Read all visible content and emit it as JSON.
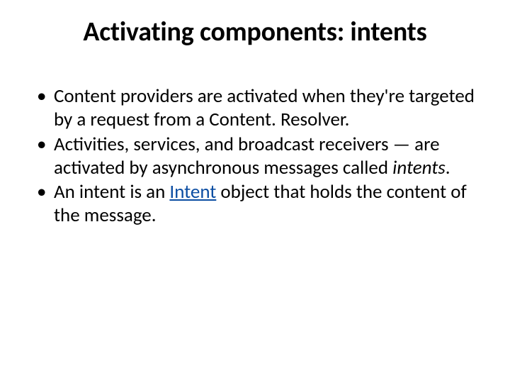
{
  "title": "Activating components: intents",
  "bullets": [
    {
      "pre": "Content providers are activated when they're targeted by a request from a Content. Resolver."
    },
    {
      "pre": "Activities, services, and broadcast receivers — are activated by asynchronous messages called ",
      "em": "intents",
      "post": "."
    },
    {
      "pre": "An intent is an ",
      "link": "Intent",
      "post": " object that holds the content of the message."
    }
  ]
}
